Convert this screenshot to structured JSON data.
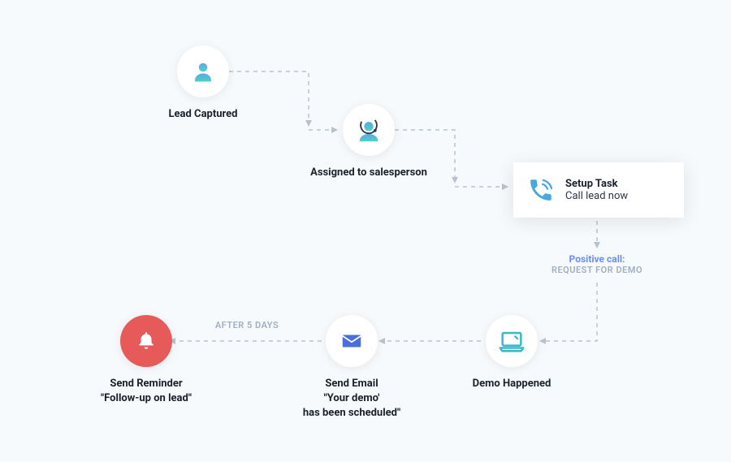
{
  "nodes": {
    "lead": {
      "label": "Lead Captured"
    },
    "assigned": {
      "label": "Assigned to salesperson"
    },
    "setup": {
      "title": "Setup Task",
      "sub": "Call lead now"
    },
    "demo": {
      "label": "Demo Happened"
    },
    "email": {
      "label": "Send Email\n\"Your demo'\nhas been scheduled\""
    },
    "reminder": {
      "label": "Send Reminder\n\"Follow-up on lead\""
    }
  },
  "edges": {
    "after5": "AFTER 5 DAYS"
  },
  "status": {
    "line1": "Positive call:",
    "line2": "REQUEST FOR DEMO"
  }
}
